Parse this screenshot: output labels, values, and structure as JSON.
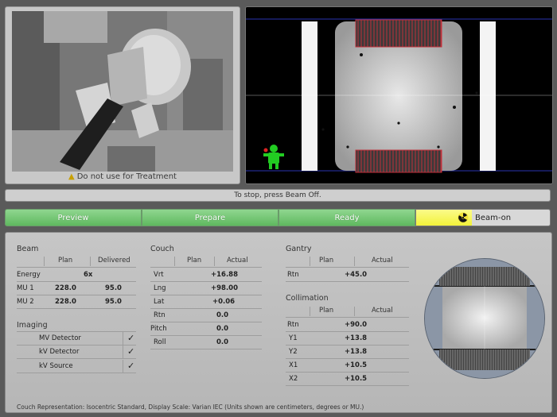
{
  "camera": {
    "caption": "Do not use for Treatment",
    "warning_icon": "warning-triangle-icon"
  },
  "status": {
    "text": "To stop, press Beam Off."
  },
  "workflow": {
    "steps": [
      "Preview",
      "Prepare",
      "Ready",
      "Beam-on"
    ],
    "active_color": "#f5f54a",
    "done_color": "#6cc56c"
  },
  "beam": {
    "title": "Beam",
    "headers": [
      "Plan",
      "Delivered"
    ],
    "rows": [
      {
        "label": "Energy",
        "plan": "6x",
        "delivered": ""
      },
      {
        "label": "MU 1",
        "plan": "228.0",
        "delivered": "95.0"
      },
      {
        "label": "MU 2",
        "plan": "228.0",
        "delivered": "95.0"
      }
    ]
  },
  "imaging": {
    "title": "Imaging",
    "rows": [
      {
        "label": "MV Detector",
        "check": "✓"
      },
      {
        "label": "kV Detector",
        "check": "✓"
      },
      {
        "label": "kV Source",
        "check": "✓"
      }
    ]
  },
  "couch": {
    "title": "Couch",
    "headers": [
      "Plan",
      "Actual"
    ],
    "rows": [
      {
        "label": "Vrt",
        "value": "+16.88"
      },
      {
        "label": "Lng",
        "value": "+98.00"
      },
      {
        "label": "Lat",
        "value": "+0.06"
      },
      {
        "label": "Rtn",
        "value": "0.0"
      },
      {
        "label": "Pitch",
        "value": "0.0"
      },
      {
        "label": "Roll",
        "value": "0.0"
      }
    ]
  },
  "gantry": {
    "title": "Gantry",
    "headers": [
      "Plan",
      "Actual"
    ],
    "rows": [
      {
        "label": "Rtn",
        "value": "+45.0"
      }
    ]
  },
  "collimation": {
    "title": "Collimation",
    "headers": [
      "Plan",
      "Actual"
    ],
    "rows": [
      {
        "label": "Rtn",
        "value": "+90.0"
      },
      {
        "label": "Y1",
        "value": "+13.8"
      },
      {
        "label": "Y2",
        "value": "+13.8"
      },
      {
        "label": "X1",
        "value": "+10.5"
      },
      {
        "label": "X2",
        "value": "+10.5"
      }
    ]
  },
  "footer": {
    "text": "Couch Representation: Isocentric Standard, Display Scale: Varian IEC (Units shown are centimeters, degrees or MU.)"
  }
}
